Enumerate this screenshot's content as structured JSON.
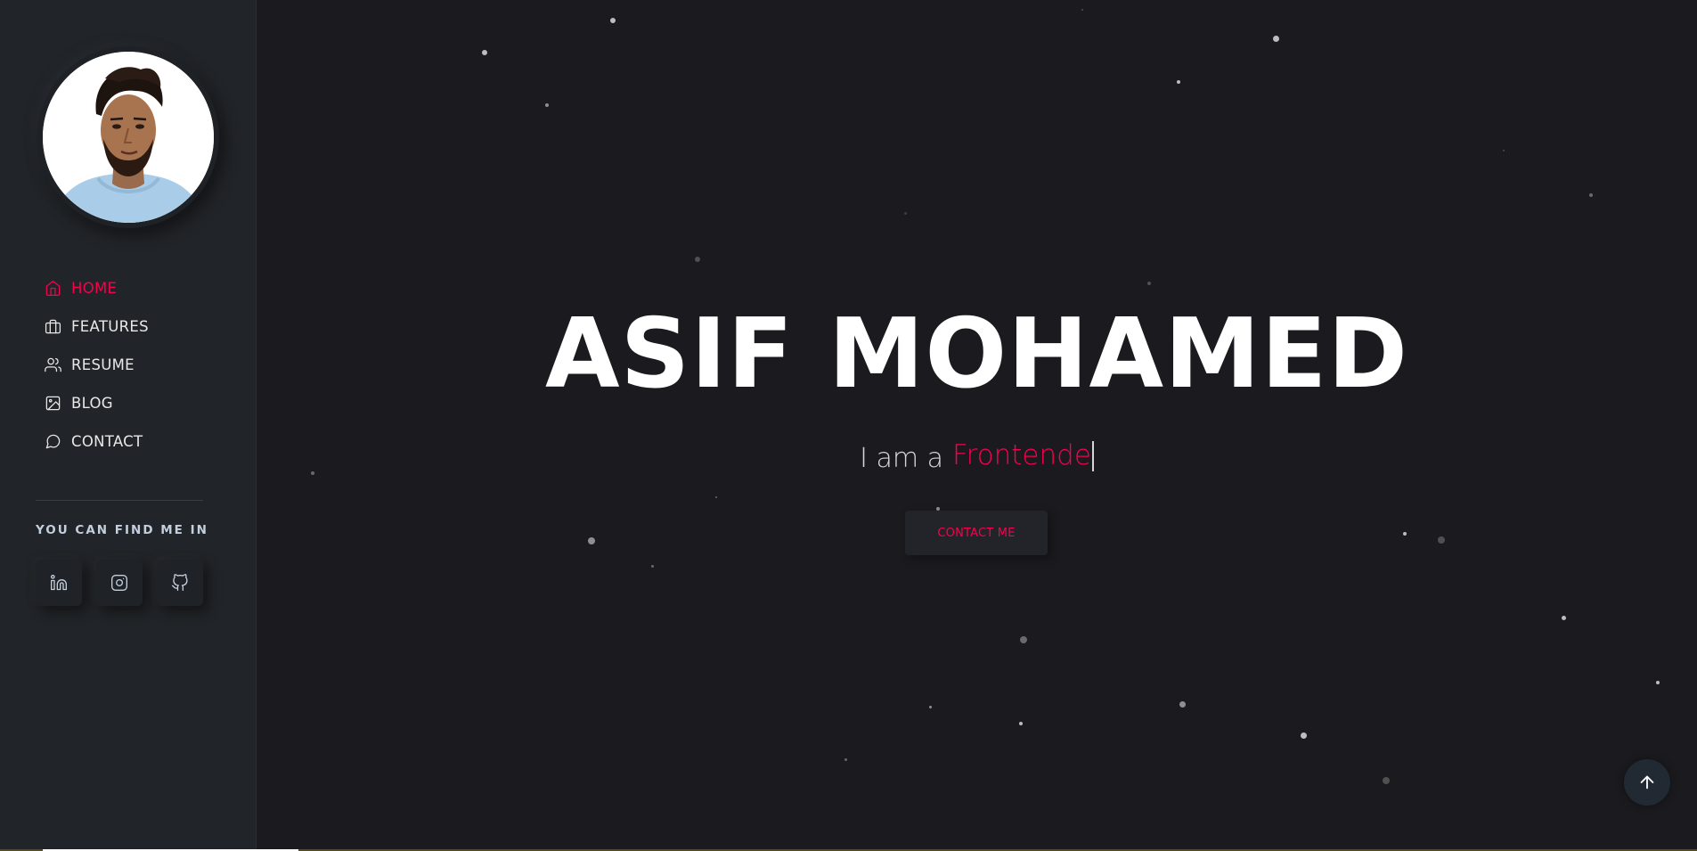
{
  "sidebar": {
    "nav": [
      {
        "label": "HOME",
        "icon": "home-icon",
        "active": true
      },
      {
        "label": "FEATURES",
        "icon": "briefcase-icon",
        "active": false
      },
      {
        "label": "RESUME",
        "icon": "users-icon",
        "active": false
      },
      {
        "label": "BLOG",
        "icon": "image-icon",
        "active": false
      },
      {
        "label": "CONTACT",
        "icon": "message-circle-icon",
        "active": false
      }
    ],
    "find_me_title": "YOU CAN FIND ME IN",
    "socials": [
      {
        "icon": "linkedin-icon"
      },
      {
        "icon": "instagram-icon"
      },
      {
        "icon": "github-icon"
      }
    ]
  },
  "hero": {
    "name": "ASIF MOHAMED",
    "prefix": "I am a",
    "role_typed": "Frontende",
    "contact_button": "CONTACT ME"
  },
  "colors": {
    "accent": "#f9004d",
    "sidebar_bg": "#212428",
    "main_bg": "#1b1a1e",
    "text": "#ffffff"
  }
}
